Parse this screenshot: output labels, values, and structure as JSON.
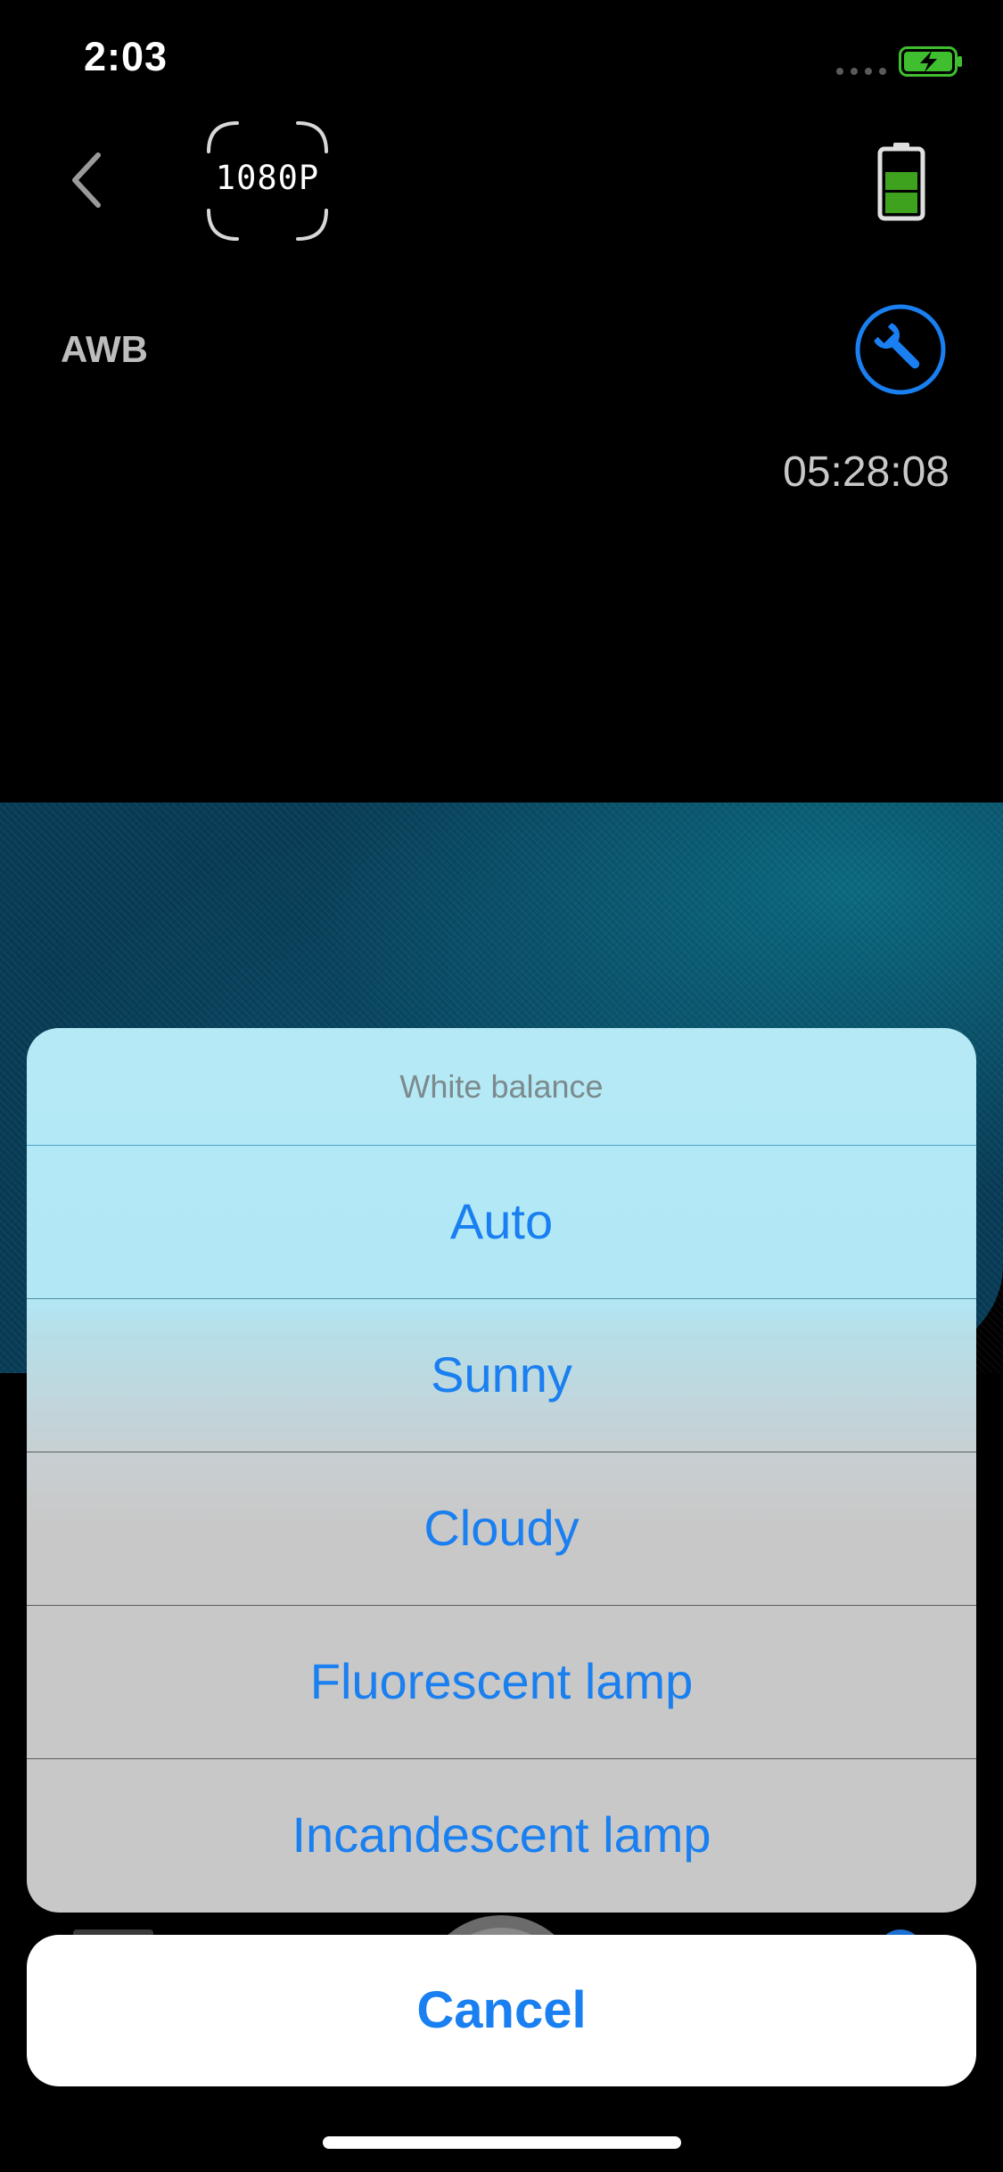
{
  "status_bar": {
    "time": "2:03",
    "battery_icon": "battery-charging-icon",
    "accent": "#3fbf2f"
  },
  "camera": {
    "back_icon": "chevron-left-icon",
    "resolution": "1080P",
    "white_balance_mode": "AWB",
    "recording_time": "05:28:08",
    "device_battery_icon": "battery-icon",
    "device_battery_level": 0.5,
    "settings_icon": "wrench-icon",
    "settings_color": "#1a7ff0"
  },
  "action_sheet": {
    "title": "White balance",
    "options": [
      {
        "label": "Auto"
      },
      {
        "label": "Sunny"
      },
      {
        "label": "Cloudy"
      },
      {
        "label": "Fluorescent lamp"
      },
      {
        "label": "Incandescent lamp"
      }
    ],
    "cancel_label": "Cancel",
    "tint": "#1a7ff0"
  }
}
